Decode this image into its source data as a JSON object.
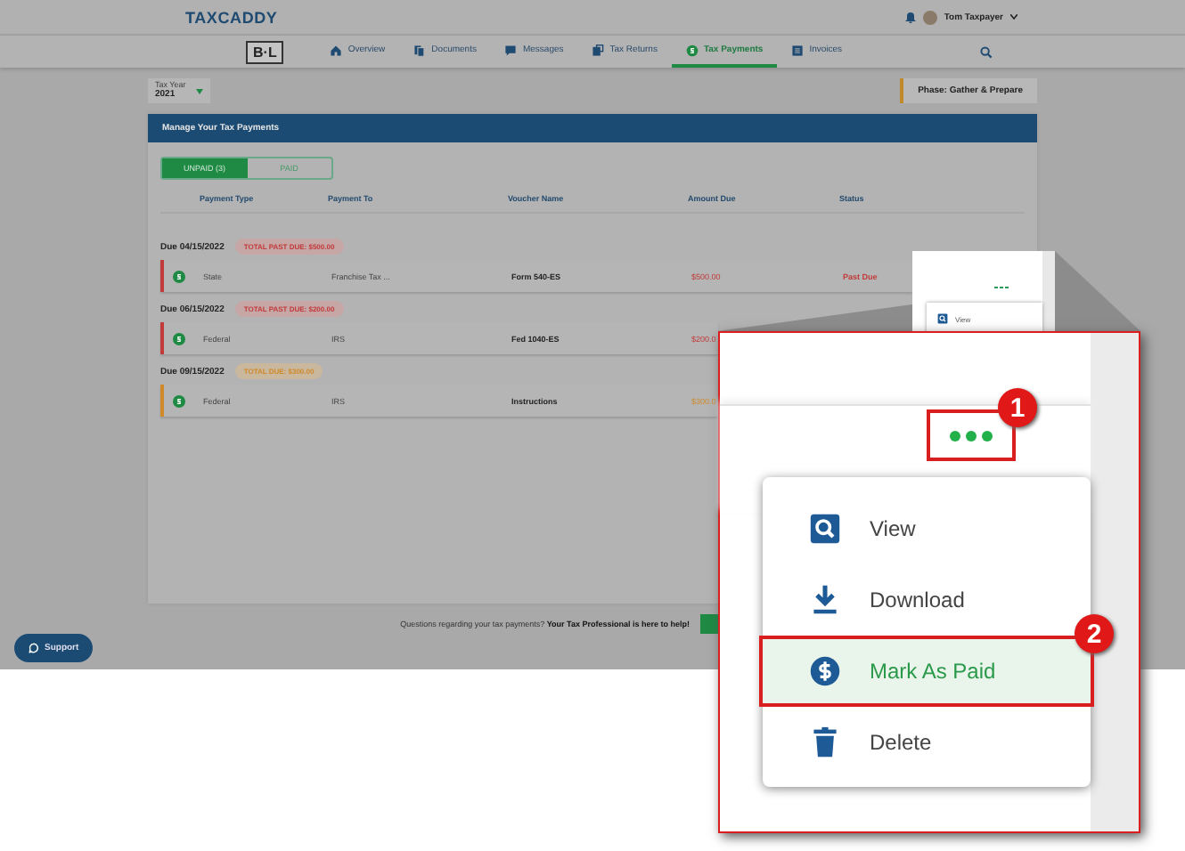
{
  "header": {
    "logo": "TAXCADDY",
    "user": "Tom Taxpayer"
  },
  "nav": {
    "firm_logo": "B·L",
    "tabs": [
      {
        "label": "Overview",
        "selected": false
      },
      {
        "label": "Documents",
        "selected": false
      },
      {
        "label": "Messages",
        "selected": false
      },
      {
        "label": "Tax Returns",
        "selected": false
      },
      {
        "label": "Tax Payments",
        "selected": true
      },
      {
        "label": "Invoices",
        "selected": false
      }
    ]
  },
  "year": {
    "label": "Tax Year",
    "value": "2021"
  },
  "phase": "Phase: Gather & Prepare",
  "card": {
    "title": "Manage Your Tax Payments",
    "filters": [
      {
        "label": "UNPAID (3)",
        "selected": true
      },
      {
        "label": "PAID",
        "selected": false
      }
    ],
    "columns": [
      "Payment Type",
      "Payment To",
      "Voucher Name",
      "Amount Due",
      "Status"
    ],
    "groups": [
      {
        "due": "Due 04/15/2022",
        "total": "TOTAL PAST DUE: $500.00",
        "kind": "past_due",
        "rows": [
          {
            "type": "State",
            "to": "Franchise Tax ...",
            "voucher": "Form 540-ES",
            "amount": "$500.00",
            "status": "Past Due"
          }
        ]
      },
      {
        "due": "Due 06/15/2022",
        "total": "TOTAL PAST DUE: $200.00",
        "kind": "past_due",
        "rows": [
          {
            "type": "Federal",
            "to": "IRS",
            "voucher": "Fed 1040-ES",
            "amount": "$200.0"
          }
        ]
      },
      {
        "due": "Due 09/15/2022",
        "total": "TOTAL DUE: $300.00",
        "kind": "due",
        "rows": [
          {
            "type": "Federal",
            "to": "IRS",
            "voucher": "Instructions",
            "amount": "$300.0"
          }
        ]
      }
    ]
  },
  "small_menu": {
    "items": [
      "View"
    ]
  },
  "footer": {
    "question": "Questions regarding your tax payments? **Your Tax Professional is here to help!**"
  },
  "support": "Support",
  "callout": {
    "markers": [
      "1",
      "2"
    ],
    "menu": [
      {
        "label": "View",
        "selected": false
      },
      {
        "label": "Download",
        "selected": false
      },
      {
        "label": "Mark As Paid",
        "selected": true
      },
      {
        "label": "Delete",
        "selected": false
      }
    ]
  }
}
